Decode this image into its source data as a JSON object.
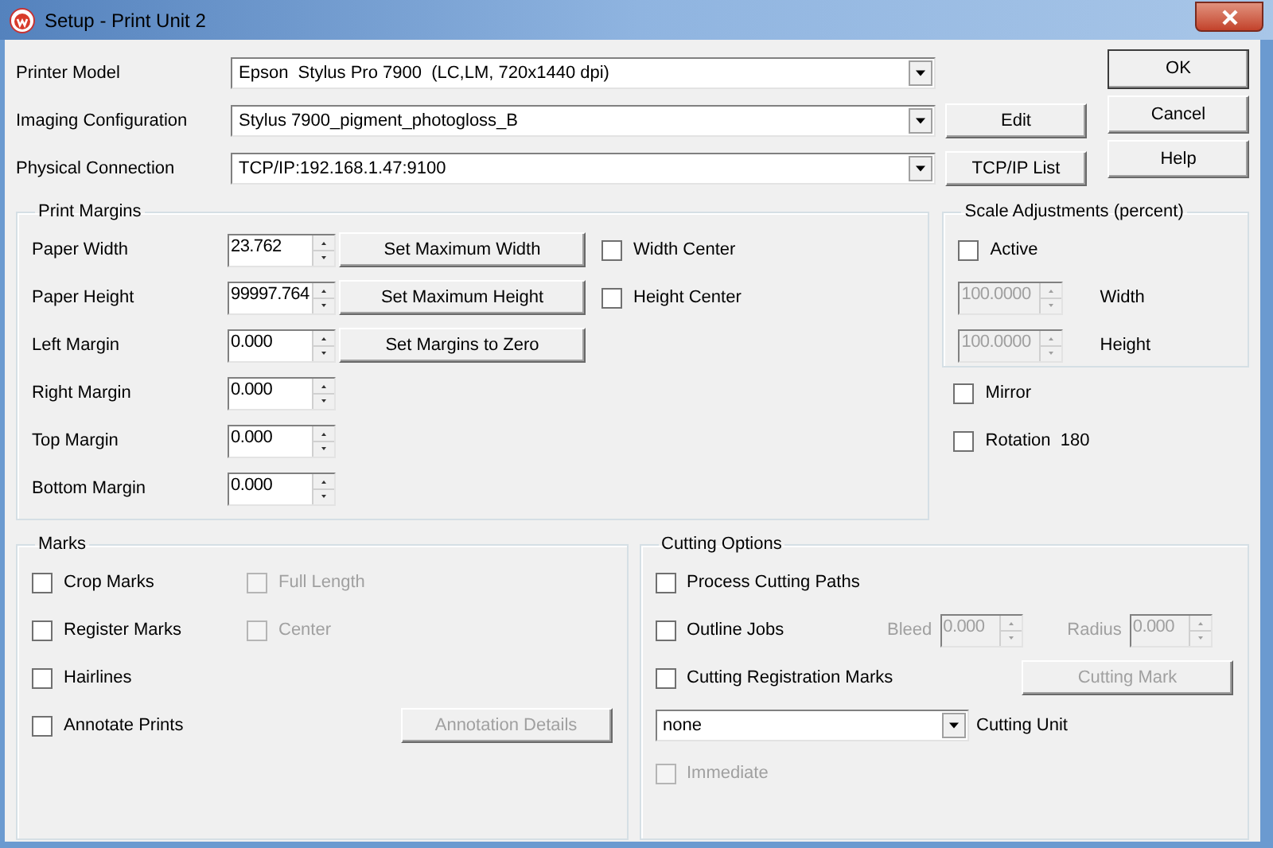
{
  "window": {
    "title": "Setup - Print Unit 2"
  },
  "top_fields": [
    {
      "label": "Printer Model",
      "value": "Epson  Stylus Pro 7900  (LC,LM, 720x1440 dpi)"
    },
    {
      "label": "Imaging Configuration",
      "value": "Stylus 7900_pigment_photogloss_B",
      "button": "Edit"
    },
    {
      "label": "Physical Connection",
      "value": "TCP/IP:192.168.1.47:9100",
      "button": "TCP/IP List"
    }
  ],
  "dialog_buttons": [
    {
      "label": "OK",
      "default": true
    },
    {
      "label": "Cancel",
      "default": false
    },
    {
      "label": "Help",
      "default": false
    }
  ],
  "print_margins": {
    "title": "Print Margins",
    "rows": [
      {
        "label": "Paper Width",
        "value": "23.762",
        "button": "Set Maximum Width",
        "checkbox": {
          "label": "Width Center",
          "checked": false
        }
      },
      {
        "label": "Paper Height",
        "value": "99997.764",
        "button": "Set Maximum Height",
        "checkbox": {
          "label": "Height Center",
          "checked": false
        }
      },
      {
        "label": "Left Margin",
        "value": "0.000",
        "button": "Set Margins to Zero"
      },
      {
        "label": "Right Margin",
        "value": "0.000"
      },
      {
        "label": "Top Margin",
        "value": "0.000"
      },
      {
        "label": "Bottom Margin",
        "value": "0.000"
      }
    ]
  },
  "scale_adjustments": {
    "title": "Scale Adjustments (percent)",
    "active": {
      "label": "Active",
      "checked": false
    },
    "fields": [
      {
        "value": "100.0000",
        "label": "Width",
        "disabled": true
      },
      {
        "value": "100.0000",
        "label": "Height",
        "disabled": true
      }
    ]
  },
  "options": [
    {
      "label": "Mirror",
      "checked": false
    },
    {
      "label": "Rotation  180",
      "checked": false
    }
  ],
  "marks": {
    "title": "Marks",
    "rows": [
      {
        "label": "Crop Marks",
        "checked": false,
        "secondary": {
          "label": "Full Length",
          "checked": false,
          "disabled": true
        }
      },
      {
        "label": "Register Marks",
        "checked": false,
        "secondary": {
          "label": "Center",
          "checked": false,
          "disabled": true
        }
      },
      {
        "label": "Hairlines",
        "checked": false
      },
      {
        "label": "Annotate Prints",
        "checked": false,
        "button": {
          "label": "Annotation Details",
          "disabled": true
        }
      }
    ]
  },
  "cutting_options": {
    "title": "Cutting Options",
    "rows": [
      {
        "kind": "checkbox",
        "label": "Process Cutting Paths",
        "checked": false,
        "disabled": false
      },
      {
        "kind": "outline",
        "label": "Outline Jobs",
        "checked": false,
        "fields": [
          {
            "label": "Bleed",
            "value": "0.000",
            "disabled": true
          },
          {
            "label": "Radius",
            "value": "0.000",
            "disabled": true
          }
        ]
      },
      {
        "kind": "checkbox_button",
        "label": "Cutting Registration Marks",
        "checked": false,
        "button": {
          "label": "Cutting Mark",
          "disabled": true
        }
      },
      {
        "kind": "select",
        "dropdown": "none",
        "caption": "Cutting Unit"
      },
      {
        "kind": "checkbox",
        "label": "Immediate",
        "checked": false,
        "disabled": true
      }
    ]
  }
}
